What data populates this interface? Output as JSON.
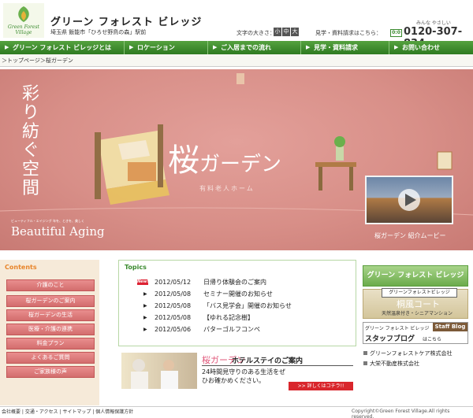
{
  "header": {
    "logo_text": "Green Forest Village",
    "site_title": "グリーン フォレスト ビレッジ",
    "address": "埼玉県 飯能市「ひろせ野鳥の森」駅前",
    "fontsize_label": "文字の大きさ：",
    "fontsize_options": [
      "小",
      "中",
      "大"
    ],
    "ruby": "みんな  やさしい",
    "request_label": "見学・資料請求はこちら：",
    "free_dial": "0:0",
    "phone": "0120-307-834"
  },
  "nav": {
    "items": [
      "グリーン フォレスト ビレッジとは",
      "ロケーション",
      "ご入居までの流れ",
      "見学・資料請求",
      "お問い合わせ"
    ]
  },
  "breadcrumb": "＞トップページ＞桜ガーデン",
  "hero": {
    "tagline": "彩り紡ぐ空間",
    "sakura_main": "桜",
    "sakura_rest": "ガーデン",
    "sakura_sub": "有料老人ホーム",
    "beautiful_note": "ビューティフル・エイジング 年を、ときを、美しく",
    "beautiful_aging": "Beautiful Aging",
    "video_caption": "桜ガーデン 紹介ムービー"
  },
  "sidebar_left": {
    "title": "Contents",
    "items": [
      "介護のこと",
      "桜ガーデンのご案内",
      "桜ガーデンの生活",
      "医療・介護の連携",
      "料金プラン",
      "よくあるご質問",
      "ご家族様の声"
    ]
  },
  "topics": {
    "title": "Topics",
    "new_badge": "New!",
    "rows": [
      {
        "date": "2012/05/12",
        "text": "日帰り体験会のご案内"
      },
      {
        "date": "2012/05/08",
        "text": "セミナー開催のお知らせ"
      },
      {
        "date": "2012/05/08",
        "text": "「バス見学会」開催のお知らせ"
      },
      {
        "date": "2012/05/08",
        "text": "【ゆれる記念樹】"
      },
      {
        "date": "2012/05/06",
        "text": "パターゴルフコンペ"
      }
    ]
  },
  "hotel": {
    "sakura": "桜ガーデン",
    "title": "ホテルステイのご案内",
    "desc": "24時間見守りのある生活をぜひお確かめください。",
    "detail": ">> 詳しくはコチラ!!"
  },
  "sidebar_right": {
    "gfv": "グリーン フォレスト ビレッジ",
    "court_title": "グリーンフォレストビレッジ",
    "court_name": "桐風コート",
    "court_sub": "天然温泉付き・シニアマンション",
    "blog_small": "グリーン フォレスト ビレッジ",
    "blog_staff": "Staff Blog",
    "blog_main": "スタッフブログ",
    "blog_here": "はこちら",
    "partners": [
      "グリーンフォレストケア株式会社",
      "大栄不動産株式会社"
    ]
  },
  "footer": {
    "links": "会社概要 | 交通・アクセス | サイトマップ | 個人情報保護方針",
    "copyright": "Copyright©Green Forest Village.All rights reserved."
  },
  "colors": {
    "nav_green": "#2e7a21",
    "hero_pink": "#d88f88",
    "side_pink": "#d36d6d",
    "accent_red": "#d9262c"
  }
}
